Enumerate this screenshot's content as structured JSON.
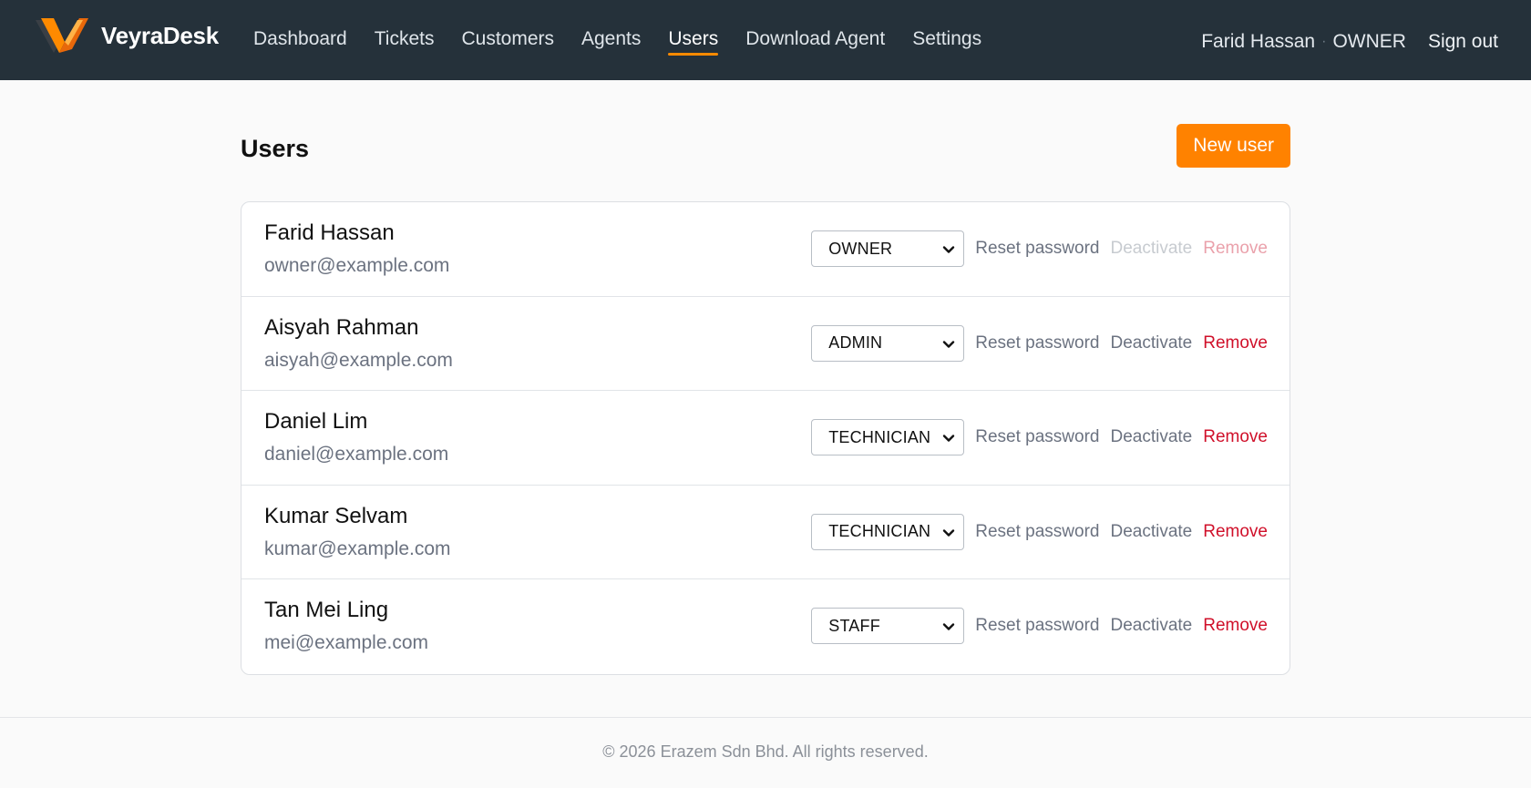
{
  "app": {
    "brand": "VeyraDesk"
  },
  "nav": {
    "items": [
      {
        "label": "Dashboard"
      },
      {
        "label": "Tickets"
      },
      {
        "label": "Customers"
      },
      {
        "label": "Agents"
      },
      {
        "label": "Users",
        "active": true
      },
      {
        "label": "Download Agent"
      },
      {
        "label": "Settings"
      }
    ]
  },
  "session": {
    "user": "Farid Hassan",
    "separator": "·",
    "role": "OWNER",
    "signout": "Sign out"
  },
  "page": {
    "title": "Users",
    "new_button": "New user"
  },
  "actions": {
    "reset": "Reset password",
    "deactivate": "Deactivate",
    "remove": "Remove"
  },
  "users": [
    {
      "name": "Farid Hassan",
      "email": "owner@example.com",
      "role": "OWNER",
      "self": true
    },
    {
      "name": "Aisyah Rahman",
      "email": "aisyah@example.com",
      "role": "ADMIN"
    },
    {
      "name": "Daniel Lim",
      "email": "daniel@example.com",
      "role": "TECHNICIAN"
    },
    {
      "name": "Kumar Selvam",
      "email": "kumar@example.com",
      "role": "TECHNICIAN"
    },
    {
      "name": "Tan Mei Ling",
      "email": "mei@example.com",
      "role": "STAFF"
    }
  ],
  "footer": {
    "text": "© 2026 Erazem Sdn Bhd. All rights reserved."
  },
  "colors": {
    "topbar": "#25313a",
    "accent": "#ff8200",
    "danger": "#d0102a"
  }
}
